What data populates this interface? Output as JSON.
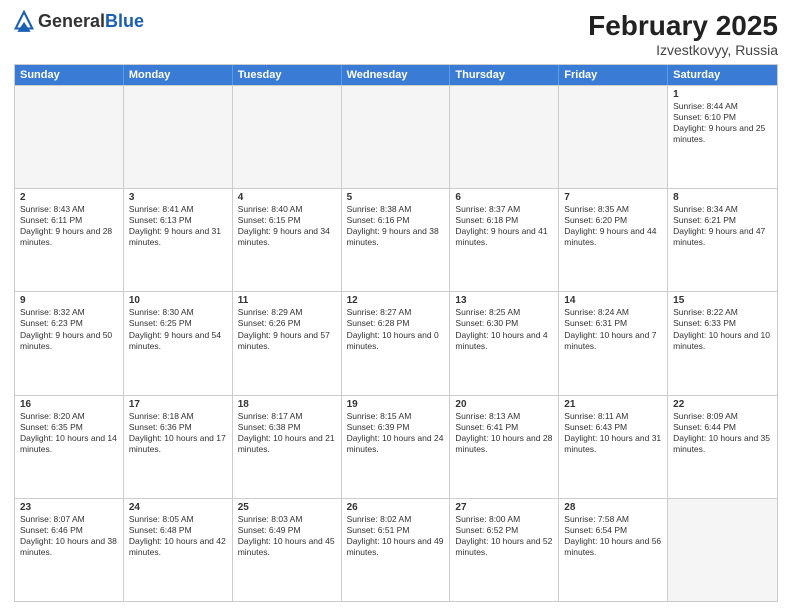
{
  "header": {
    "logo_general": "General",
    "logo_blue": "Blue",
    "month_title": "February 2025",
    "location": "Izvestkovyy, Russia"
  },
  "days_of_week": [
    "Sunday",
    "Monday",
    "Tuesday",
    "Wednesday",
    "Thursday",
    "Friday",
    "Saturday"
  ],
  "rows": [
    [
      {
        "num": "",
        "info": "",
        "empty": true
      },
      {
        "num": "",
        "info": "",
        "empty": true
      },
      {
        "num": "",
        "info": "",
        "empty": true
      },
      {
        "num": "",
        "info": "",
        "empty": true
      },
      {
        "num": "",
        "info": "",
        "empty": true
      },
      {
        "num": "",
        "info": "",
        "empty": true
      },
      {
        "num": "1",
        "info": "Sunrise: 8:44 AM\nSunset: 6:10 PM\nDaylight: 9 hours and 25 minutes.",
        "empty": false
      }
    ],
    [
      {
        "num": "2",
        "info": "Sunrise: 8:43 AM\nSunset: 6:11 PM\nDaylight: 9 hours and 28 minutes.",
        "empty": false
      },
      {
        "num": "3",
        "info": "Sunrise: 8:41 AM\nSunset: 6:13 PM\nDaylight: 9 hours and 31 minutes.",
        "empty": false
      },
      {
        "num": "4",
        "info": "Sunrise: 8:40 AM\nSunset: 6:15 PM\nDaylight: 9 hours and 34 minutes.",
        "empty": false
      },
      {
        "num": "5",
        "info": "Sunrise: 8:38 AM\nSunset: 6:16 PM\nDaylight: 9 hours and 38 minutes.",
        "empty": false
      },
      {
        "num": "6",
        "info": "Sunrise: 8:37 AM\nSunset: 6:18 PM\nDaylight: 9 hours and 41 minutes.",
        "empty": false
      },
      {
        "num": "7",
        "info": "Sunrise: 8:35 AM\nSunset: 6:20 PM\nDaylight: 9 hours and 44 minutes.",
        "empty": false
      },
      {
        "num": "8",
        "info": "Sunrise: 8:34 AM\nSunset: 6:21 PM\nDaylight: 9 hours and 47 minutes.",
        "empty": false
      }
    ],
    [
      {
        "num": "9",
        "info": "Sunrise: 8:32 AM\nSunset: 6:23 PM\nDaylight: 9 hours and 50 minutes.",
        "empty": false
      },
      {
        "num": "10",
        "info": "Sunrise: 8:30 AM\nSunset: 6:25 PM\nDaylight: 9 hours and 54 minutes.",
        "empty": false
      },
      {
        "num": "11",
        "info": "Sunrise: 8:29 AM\nSunset: 6:26 PM\nDaylight: 9 hours and 57 minutes.",
        "empty": false
      },
      {
        "num": "12",
        "info": "Sunrise: 8:27 AM\nSunset: 6:28 PM\nDaylight: 10 hours and 0 minutes.",
        "empty": false
      },
      {
        "num": "13",
        "info": "Sunrise: 8:25 AM\nSunset: 6:30 PM\nDaylight: 10 hours and 4 minutes.",
        "empty": false
      },
      {
        "num": "14",
        "info": "Sunrise: 8:24 AM\nSunset: 6:31 PM\nDaylight: 10 hours and 7 minutes.",
        "empty": false
      },
      {
        "num": "15",
        "info": "Sunrise: 8:22 AM\nSunset: 6:33 PM\nDaylight: 10 hours and 10 minutes.",
        "empty": false
      }
    ],
    [
      {
        "num": "16",
        "info": "Sunrise: 8:20 AM\nSunset: 6:35 PM\nDaylight: 10 hours and 14 minutes.",
        "empty": false
      },
      {
        "num": "17",
        "info": "Sunrise: 8:18 AM\nSunset: 6:36 PM\nDaylight: 10 hours and 17 minutes.",
        "empty": false
      },
      {
        "num": "18",
        "info": "Sunrise: 8:17 AM\nSunset: 6:38 PM\nDaylight: 10 hours and 21 minutes.",
        "empty": false
      },
      {
        "num": "19",
        "info": "Sunrise: 8:15 AM\nSunset: 6:39 PM\nDaylight: 10 hours and 24 minutes.",
        "empty": false
      },
      {
        "num": "20",
        "info": "Sunrise: 8:13 AM\nSunset: 6:41 PM\nDaylight: 10 hours and 28 minutes.",
        "empty": false
      },
      {
        "num": "21",
        "info": "Sunrise: 8:11 AM\nSunset: 6:43 PM\nDaylight: 10 hours and 31 minutes.",
        "empty": false
      },
      {
        "num": "22",
        "info": "Sunrise: 8:09 AM\nSunset: 6:44 PM\nDaylight: 10 hours and 35 minutes.",
        "empty": false
      }
    ],
    [
      {
        "num": "23",
        "info": "Sunrise: 8:07 AM\nSunset: 6:46 PM\nDaylight: 10 hours and 38 minutes.",
        "empty": false
      },
      {
        "num": "24",
        "info": "Sunrise: 8:05 AM\nSunset: 6:48 PM\nDaylight: 10 hours and 42 minutes.",
        "empty": false
      },
      {
        "num": "25",
        "info": "Sunrise: 8:03 AM\nSunset: 6:49 PM\nDaylight: 10 hours and 45 minutes.",
        "empty": false
      },
      {
        "num": "26",
        "info": "Sunrise: 8:02 AM\nSunset: 6:51 PM\nDaylight: 10 hours and 49 minutes.",
        "empty": false
      },
      {
        "num": "27",
        "info": "Sunrise: 8:00 AM\nSunset: 6:52 PM\nDaylight: 10 hours and 52 minutes.",
        "empty": false
      },
      {
        "num": "28",
        "info": "Sunrise: 7:58 AM\nSunset: 6:54 PM\nDaylight: 10 hours and 56 minutes.",
        "empty": false
      },
      {
        "num": "",
        "info": "",
        "empty": true
      }
    ]
  ]
}
